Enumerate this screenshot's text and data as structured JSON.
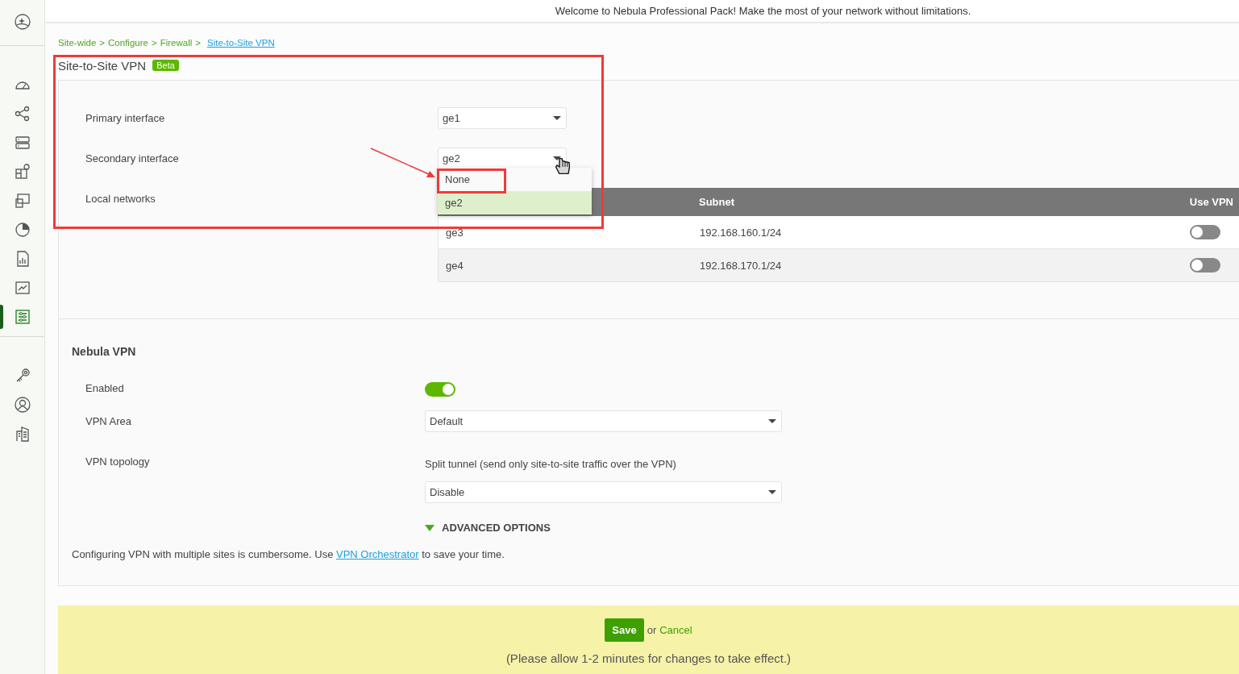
{
  "banner": {
    "text": "Welcome to Nebula Professional Pack! Make the most of your network without limitations."
  },
  "sidebar": {
    "items": [
      {
        "kind": "logo",
        "selected": false
      },
      {
        "kind": "divider"
      },
      {
        "kind": "dashboard",
        "selected": false
      },
      {
        "kind": "topology",
        "selected": false
      },
      {
        "kind": "devices",
        "selected": false
      },
      {
        "kind": "map",
        "selected": false
      },
      {
        "kind": "clients",
        "selected": false
      },
      {
        "kind": "pie",
        "selected": false
      },
      {
        "kind": "report",
        "selected": false
      },
      {
        "kind": "chart",
        "selected": false
      },
      {
        "kind": "configure",
        "selected": true
      },
      {
        "kind": "divider"
      },
      {
        "kind": "key",
        "selected": false
      },
      {
        "kind": "support",
        "selected": false
      },
      {
        "kind": "building",
        "selected": false
      }
    ]
  },
  "breadcrumb": {
    "separator": ">",
    "items": [
      {
        "label": "Site-wide",
        "current": false
      },
      {
        "label": "Configure",
        "current": false
      },
      {
        "label": "Firewall",
        "current": false
      },
      {
        "label": "Site-to-Site VPN",
        "current": true
      }
    ]
  },
  "page_title": "Site-to-Site VPN",
  "badge": "Beta",
  "interfaces": [
    {
      "label": "Primary interface",
      "value": "ge1"
    },
    {
      "label": "Secondary interface",
      "value": "ge2",
      "expanded": true,
      "options": [
        {
          "label": "None",
          "selected": false
        },
        {
          "label": "ge2",
          "selected": true
        }
      ]
    }
  ],
  "local_networks": {
    "label": "Local networks",
    "columns": [
      "Subnet",
      "Use VPN"
    ],
    "rows": [
      {
        "interface": "ge3",
        "subnet": "192.168.160.1/24",
        "use_vpn": false
      },
      {
        "interface": "ge4",
        "subnet": "192.168.170.1/24",
        "use_vpn": false
      }
    ]
  },
  "nebula_vpn": {
    "title": "Nebula VPN",
    "enabled": {
      "label": "Enabled",
      "on": true
    },
    "vpn_area": {
      "label": "VPN Area",
      "value": "Default"
    },
    "vpn_topology": {
      "label": "VPN topology",
      "split_tunnel_label": "Split tunnel (send only site-to-site traffic over the VPN)",
      "value": "Disable"
    },
    "advanced_options": "ADVANCED OPTIONS",
    "note": {
      "before": "Configuring VPN with multiple sites is cumbersome. Use ",
      "link": "VPN Orchestrator",
      "after": " to save your time."
    }
  },
  "save_bar": {
    "save": "Save",
    "or": "or",
    "cancel": "Cancel",
    "note": "(Please allow 1-2 minutes for changes to take effect.)"
  }
}
